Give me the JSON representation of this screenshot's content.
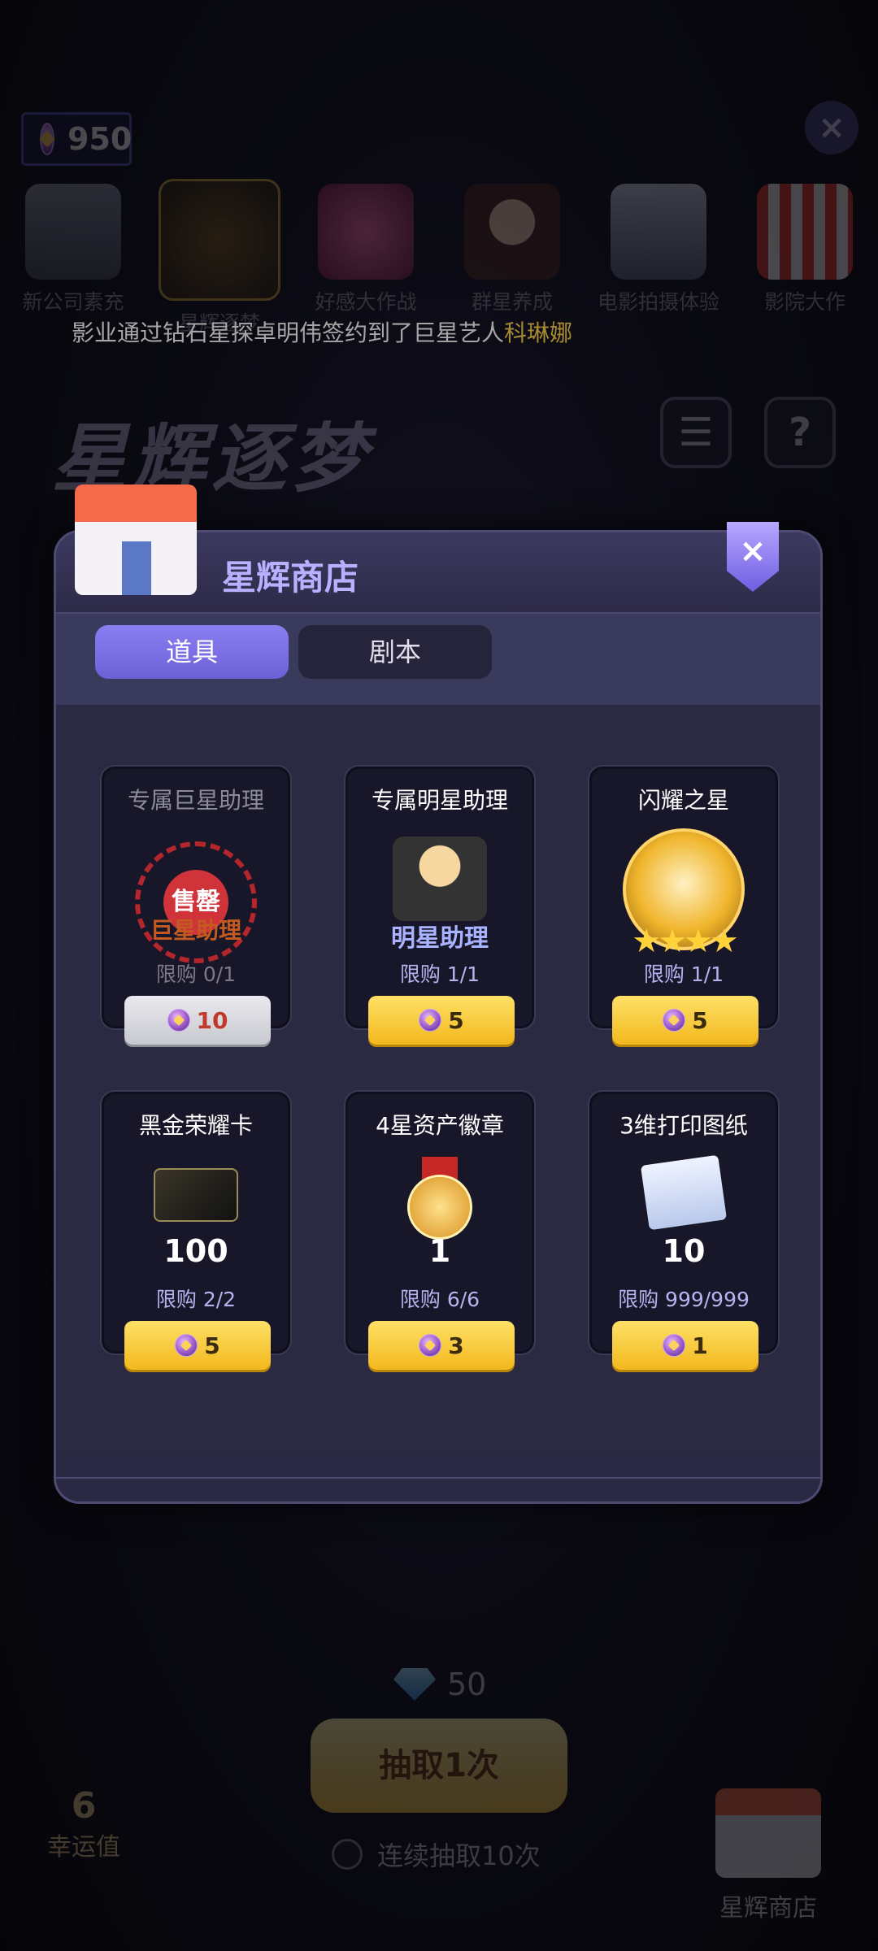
{
  "top_bar": {
    "currency_value": "950",
    "close_icon": "×"
  },
  "nav": [
    {
      "label": "新公司素充"
    },
    {
      "label": "星辉逐梦"
    },
    {
      "label": "好感大作战"
    },
    {
      "label": "群星养成"
    },
    {
      "label": "电影拍摄体验"
    },
    {
      "label": "影院大作"
    }
  ],
  "ticker": {
    "prefix": "影业通过钻石星探卓明伟签约到了巨星艺人",
    "name": "科琳娜"
  },
  "background": {
    "title": "星辉逐梦",
    "menu_icon": "☰",
    "help_icon": "?",
    "gem_cost": "50",
    "draw_label": "抽取1次",
    "ten_label": "连续抽取10次",
    "luck_value": "6",
    "luck_label": "幸运值",
    "shop_label": "星辉商店"
  },
  "modal": {
    "title": "星辉商店",
    "close_icon": "×",
    "tabs": [
      {
        "label": "道具",
        "active": true
      },
      {
        "label": "剧本",
        "active": false
      }
    ],
    "items": [
      {
        "title": "专属巨星助理",
        "limit": "限购 0/1",
        "price": "10",
        "sold_out": true,
        "stamp": "售罄",
        "stamp_sub": "巨星助理"
      },
      {
        "title": "专属明星助理",
        "limit": "限购 1/1",
        "price": "5",
        "sold_out": false,
        "image_label": "明星助理"
      },
      {
        "title": "闪耀之星",
        "limit": "限购 1/1",
        "price": "5",
        "sold_out": false,
        "stars": "★★★★"
      },
      {
        "title": "黑金荣耀卡",
        "limit": "限购 2/2",
        "price": "5",
        "qty": "100"
      },
      {
        "title": "4星资产徽章",
        "limit": "限购 6/6",
        "price": "3",
        "qty": "1"
      },
      {
        "title": "3维打印图纸",
        "limit": "限购 999/999",
        "price": "1",
        "qty": "10"
      }
    ]
  },
  "colors": {
    "accent": "#6c61d6",
    "price_button": "#f2b81d",
    "sold_red": "#d0333a"
  }
}
